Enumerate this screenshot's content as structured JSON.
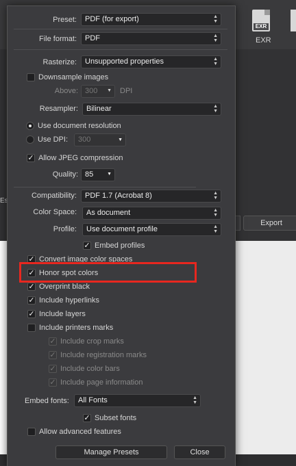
{
  "background": {
    "exr_icon_text": "EXR",
    "exr_label": "EXR",
    "export_button": "Export",
    "left_cut_text": "Es"
  },
  "dialog": {
    "preset": {
      "label": "Preset:",
      "value": "PDF (for export)"
    },
    "file_format": {
      "label": "File format:",
      "value": "PDF"
    },
    "rasterize": {
      "label": "Rasterize:",
      "value": "Unsupported properties"
    },
    "downsample": {
      "label": "Downsample images",
      "checked": false
    },
    "above": {
      "label": "Above:",
      "value": "300",
      "unit": "DPI"
    },
    "resampler": {
      "label": "Resampler:",
      "value": "Bilinear"
    },
    "use_doc_res": {
      "label": "Use document resolution",
      "selected": true
    },
    "use_dpi": {
      "label": "Use DPI:",
      "value": "300",
      "selected": false
    },
    "jpeg": {
      "label": "Allow JPEG compression",
      "checked": true
    },
    "quality": {
      "label": "Quality:",
      "value": "85"
    },
    "compatibility": {
      "label": "Compatibility:",
      "value": "PDF 1.7 (Acrobat 8)"
    },
    "color_space": {
      "label": "Color Space:",
      "value": "As document"
    },
    "profile": {
      "label": "Profile:",
      "value": "Use document profile"
    },
    "embed_profiles": {
      "label": "Embed profiles",
      "checked": true
    },
    "options": [
      {
        "label": "Convert image color spaces",
        "checked": true
      },
      {
        "label": "Honor spot colors",
        "checked": true
      },
      {
        "label": "Overprint black",
        "checked": true
      },
      {
        "label": "Include hyperlinks",
        "checked": true
      },
      {
        "label": "Include layers",
        "checked": true
      },
      {
        "label": "Include printers marks",
        "checked": false
      }
    ],
    "marks": [
      {
        "label": "Include crop marks",
        "checked": true
      },
      {
        "label": "Include registration marks",
        "checked": true
      },
      {
        "label": "Include color bars",
        "checked": true
      },
      {
        "label": "Include page information",
        "checked": true
      }
    ],
    "embed_fonts": {
      "label": "Embed  fonts:",
      "value": "All Fonts"
    },
    "subset_fonts": {
      "label": "Subset fonts",
      "checked": true
    },
    "advanced": {
      "label": "Allow advanced features",
      "checked": false
    },
    "manage_presets": "Manage Presets",
    "close": "Close",
    "check_glyph": "✓",
    "arrow_up": "▲",
    "arrow_down": "▼"
  },
  "colors": {
    "highlight": "#e8271f",
    "dialog_bg": "#3b3b3e"
  }
}
